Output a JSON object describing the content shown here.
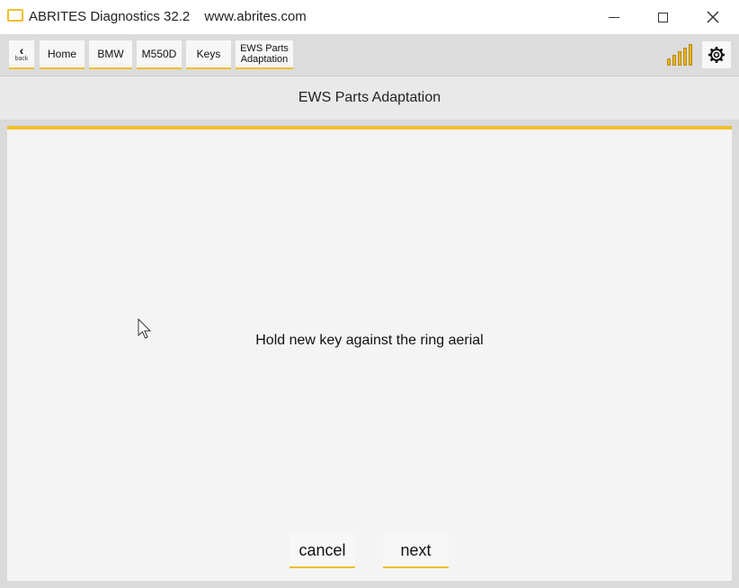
{
  "window": {
    "app_name": "ABRITES Diagnostics 32.2",
    "website": "www.abrites.com",
    "controls": {
      "minimize": "minimize-icon",
      "maximize": "maximize-icon",
      "close": "close-icon"
    }
  },
  "breadcrumbs": {
    "back_label": "back",
    "items": [
      "Home",
      "BMW",
      "M550D",
      "Keys"
    ],
    "current": [
      "EWS Parts",
      "Adaptation"
    ]
  },
  "status": {
    "signal_icon": "signal-strength-icon",
    "signal_bars": 5,
    "settings_icon": "gear-icon"
  },
  "page": {
    "title": "EWS Parts Adaptation",
    "message": "Hold new key against the ring aerial"
  },
  "actions": {
    "cancel_label": "cancel",
    "next_label": "next"
  },
  "colors": {
    "accent": "#f2bf2c",
    "background": "#f4f4f4"
  }
}
